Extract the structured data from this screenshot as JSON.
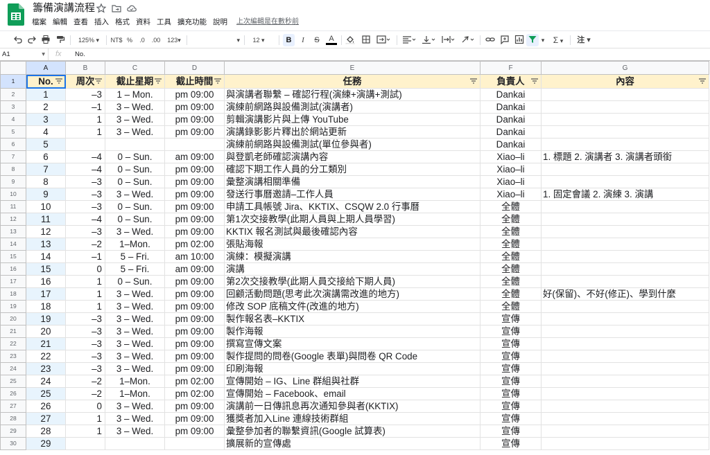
{
  "app": {
    "title": "籌備演講流程",
    "menus": [
      "檔案",
      "編輯",
      "查看",
      "插入",
      "格式",
      "資料",
      "工具",
      "擴充功能",
      "說明"
    ],
    "last_edit": "上次編輯是在數秒前"
  },
  "toolbar": {
    "zoom": "125%",
    "currency": "NT$",
    "percent": "%",
    "dec_less": ".0",
    "dec_more": ".00",
    "format": "123",
    "font_size": "12",
    "bold": "B",
    "italic": "I",
    "strike": "S",
    "text_color": "A",
    "sigma": "Σ",
    "comment": "注"
  },
  "formula": {
    "cell": "A1",
    "fx": "fx",
    "content": "No."
  },
  "columns": [
    "A",
    "B",
    "C",
    "D",
    "E",
    "F",
    "G"
  ],
  "headers": [
    "No.",
    "周次",
    "截止星期",
    "截止時間",
    "任務",
    "負責人",
    "內容"
  ],
  "rows": [
    {
      "n": "2",
      "a": "1",
      "b": "–3",
      "c": "1 – Mon.",
      "d": "pm 09:00",
      "e": "與演講者聯繫 – 確認行程(演練+演講+測試)",
      "f": "Dankai",
      "g": ""
    },
    {
      "n": "3",
      "a": "2",
      "b": "–1",
      "c": "3 – Wed.",
      "d": "pm 09:00",
      "e": "演練前網路與設備測試(演講者)",
      "f": "Dankai",
      "g": ""
    },
    {
      "n": "4",
      "a": "3",
      "b": "1",
      "c": "3 – Wed.",
      "d": "pm 09:00",
      "e": "剪輯演講影片與上傳 YouTube",
      "f": "Dankai",
      "g": ""
    },
    {
      "n": "5",
      "a": "4",
      "b": "1",
      "c": "3 – Wed.",
      "d": "pm 09:00",
      "e": "演講錄影影片釋出於網站更新",
      "f": "Dankai",
      "g": ""
    },
    {
      "n": "6",
      "a": "5",
      "b": "",
      "c": "",
      "d": "",
      "e": "演練前網路與設備測試(單位參與者)",
      "f": "Dankai",
      "g": ""
    },
    {
      "n": "7",
      "a": "6",
      "b": "–4",
      "c": "0 – Sun.",
      "d": "am 09:00",
      "e": "與登凱老師確認演講內容",
      "f": "Xiao–li",
      "g": "1. 標題 2. 演講者 3. 演講者頭銜"
    },
    {
      "n": "8",
      "a": "7",
      "b": "–4",
      "c": "0 – Sun.",
      "d": "pm 09:00",
      "e": "確認下期工作人員的分工類別",
      "f": "Xiao–li",
      "g": ""
    },
    {
      "n": "9",
      "a": "8",
      "b": "–3",
      "c": "0 – Sun.",
      "d": "pm 09:00",
      "e": "彙整演講相關準備",
      "f": "Xiao–li",
      "g": ""
    },
    {
      "n": "10",
      "a": "9",
      "b": "–3",
      "c": "3 – Wed.",
      "d": "pm 09:00",
      "e": "發送行事曆邀請–工作人員",
      "f": "Xiao–li",
      "g": "1. 固定會議 2. 演練 3. 演講"
    },
    {
      "n": "11",
      "a": "10",
      "b": "–3",
      "c": "0 – Sun.",
      "d": "pm 09:00",
      "e": "申請工具帳號 Jira、KKTIX、CSQW 2.0 行事曆",
      "f": "全體",
      "g": ""
    },
    {
      "n": "12",
      "a": "11",
      "b": "–4",
      "c": "0 – Sun.",
      "d": "pm 09:00",
      "e": "第1次交接教學(此期人員與上期人員學習)",
      "f": "全體",
      "g": ""
    },
    {
      "n": "13",
      "a": "12",
      "b": "–3",
      "c": "3 – Wed.",
      "d": "pm 09:00",
      "e": "KKTIX 報名測試與最後確認內容",
      "f": "全體",
      "g": ""
    },
    {
      "n": "14",
      "a": "13",
      "b": "–2",
      "c": "1–Mon.",
      "d": "pm 02:00",
      "e": "張貼海報",
      "f": "全體",
      "g": ""
    },
    {
      "n": "15",
      "a": "14",
      "b": "–1",
      "c": "5 – Fri.",
      "d": "am 10:00",
      "e": "演練：模擬演講",
      "f": "全體",
      "g": ""
    },
    {
      "n": "16",
      "a": "15",
      "b": "0",
      "c": "5 – Fri.",
      "d": "am 09:00",
      "e": "演講",
      "f": "全體",
      "g": ""
    },
    {
      "n": "17",
      "a": "16",
      "b": "1",
      "c": "0 – Sun.",
      "d": "pm 09:00",
      "e": "第2次交接教學(此期人員交接給下期人員)",
      "f": "全體",
      "g": ""
    },
    {
      "n": "18",
      "a": "17",
      "b": "1",
      "c": "3 – Wed.",
      "d": "pm 09:00",
      "e": "回顧活動問題(思考此次演講需改進的地方)",
      "f": "全體",
      "g": "好(保留)、不好(修正)、學到什麼"
    },
    {
      "n": "19",
      "a": "18",
      "b": "1",
      "c": "3 – Wed.",
      "d": "pm 09:00",
      "e": "修改 SOP 底稿文件(改進的地方)",
      "f": "全體",
      "g": ""
    },
    {
      "n": "20",
      "a": "19",
      "b": "–3",
      "c": "3 – Wed.",
      "d": "pm 09:00",
      "e": "製作報名表–KKTIX",
      "f": "宣傳",
      "g": ""
    },
    {
      "n": "21",
      "a": "20",
      "b": "–3",
      "c": "3 – Wed.",
      "d": "pm 09:00",
      "e": "製作海報",
      "f": "宣傳",
      "g": ""
    },
    {
      "n": "22",
      "a": "21",
      "b": "–3",
      "c": "3 – Wed.",
      "d": "pm 09:00",
      "e": "撰寫宣傳文案",
      "f": "宣傳",
      "g": ""
    },
    {
      "n": "23",
      "a": "22",
      "b": "–3",
      "c": "3 – Wed.",
      "d": "pm 09:00",
      "e": "製作提問的問卷(Google 表單)與問卷 QR Code",
      "f": "宣傳",
      "g": ""
    },
    {
      "n": "24",
      "a": "23",
      "b": "–3",
      "c": "3 – Wed.",
      "d": "pm 09:00",
      "e": "印刷海報",
      "f": "宣傳",
      "g": ""
    },
    {
      "n": "25",
      "a": "24",
      "b": "–2",
      "c": "1–Mon.",
      "d": "pm 02:00",
      "e": "宣傳開始 – IG、Line 群組與社群",
      "f": "宣傳",
      "g": ""
    },
    {
      "n": "26",
      "a": "25",
      "b": "–2",
      "c": "1–Mon.",
      "d": "pm 02:00",
      "e": "宣傳開始 – Facebook、email",
      "f": "宣傳",
      "g": ""
    },
    {
      "n": "27",
      "a": "26",
      "b": "0",
      "c": "3 – Wed.",
      "d": "pm 09:00",
      "e": "演講前一日傳訊息再次通知參與者(KKTIX)",
      "f": "宣傳",
      "g": ""
    },
    {
      "n": "28",
      "a": "27",
      "b": "1",
      "c": "3 – Wed.",
      "d": "pm 09:00",
      "e": "獲獎者加入Line 連線技術群組",
      "f": "宣傳",
      "g": ""
    },
    {
      "n": "29",
      "a": "28",
      "b": "1",
      "c": "3 – Wed.",
      "d": "pm 09:00",
      "e": "彙整參加者的聯繫資訊(Google 試算表)",
      "f": "宣傳",
      "g": ""
    },
    {
      "n": "30",
      "a": "29",
      "b": "",
      "c": "",
      "d": "",
      "e": "擴展新的宣傳處",
      "f": "宣傳",
      "g": ""
    }
  ],
  "colors": {
    "header_bg": "#fff2cc",
    "band": "#e8f4fd",
    "accent": "#1a73e8",
    "sheets_green": "#0f9d58"
  }
}
